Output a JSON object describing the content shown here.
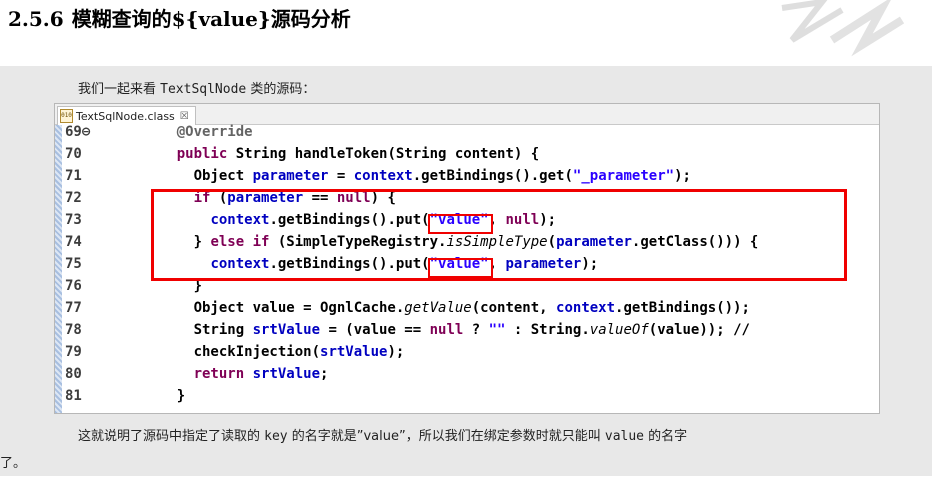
{
  "heading": {
    "number": "2.5.6",
    "title": "模糊查询的${value}源码分析"
  },
  "intro": {
    "before": "我们一起来看 ",
    "class_name": "TextSqlNode",
    "after": " 类的源码："
  },
  "editor": {
    "tab_label": "TextSqlNode.class",
    "tab_close": "☒",
    "file_icon_text": "010",
    "lines": [
      {
        "num": "69⊖",
        "parts": [
          {
            "t": "    ",
            "c": ""
          },
          {
            "t": "@Override",
            "c": "ann"
          }
        ]
      },
      {
        "num": "70",
        "parts": [
          {
            "t": "    ",
            "c": ""
          },
          {
            "t": "public",
            "c": "kw"
          },
          {
            "t": " String handleToken(String content) {",
            "c": ""
          }
        ]
      },
      {
        "num": "71",
        "parts": [
          {
            "t": "      Object ",
            "c": ""
          },
          {
            "t": "parameter",
            "c": "fld"
          },
          {
            "t": " = ",
            "c": ""
          },
          {
            "t": "context",
            "c": "fld"
          },
          {
            "t": ".getBindings().get(",
            "c": ""
          },
          {
            "t": "\"_parameter\"",
            "c": "str"
          },
          {
            "t": ");",
            "c": ""
          }
        ]
      },
      {
        "num": "72",
        "parts": [
          {
            "t": "      ",
            "c": ""
          },
          {
            "t": "if",
            "c": "kw"
          },
          {
            "t": " (",
            "c": ""
          },
          {
            "t": "parameter",
            "c": "fld"
          },
          {
            "t": " == ",
            "c": ""
          },
          {
            "t": "null",
            "c": "kw"
          },
          {
            "t": ") {",
            "c": ""
          }
        ]
      },
      {
        "num": "73",
        "parts": [
          {
            "t": "        ",
            "c": ""
          },
          {
            "t": "context",
            "c": "fld"
          },
          {
            "t": ".getBindings().put(",
            "c": ""
          },
          {
            "t": "\"value\"",
            "c": "str"
          },
          {
            "t": ", ",
            "c": ""
          },
          {
            "t": "null",
            "c": "kw"
          },
          {
            "t": ");",
            "c": ""
          }
        ]
      },
      {
        "num": "74",
        "parts": [
          {
            "t": "      } ",
            "c": ""
          },
          {
            "t": "else",
            "c": "kw"
          },
          {
            "t": " ",
            "c": ""
          },
          {
            "t": "if",
            "c": "kw"
          },
          {
            "t": " (SimpleTypeRegistry.",
            "c": ""
          },
          {
            "t": "isSimpleType",
            "c": "it"
          },
          {
            "t": "(",
            "c": ""
          },
          {
            "t": "parameter",
            "c": "fld"
          },
          {
            "t": ".getClass())) {",
            "c": ""
          }
        ]
      },
      {
        "num": "75",
        "parts": [
          {
            "t": "        ",
            "c": ""
          },
          {
            "t": "context",
            "c": "fld"
          },
          {
            "t": ".getBindings().put(",
            "c": ""
          },
          {
            "t": "\"value\"",
            "c": "str"
          },
          {
            "t": ", ",
            "c": ""
          },
          {
            "t": "parameter",
            "c": "fld"
          },
          {
            "t": ");",
            "c": ""
          }
        ]
      },
      {
        "num": "76",
        "parts": [
          {
            "t": "      }",
            "c": ""
          }
        ]
      },
      {
        "num": "77",
        "parts": [
          {
            "t": "      Object value = OgnlCache.",
            "c": ""
          },
          {
            "t": "getValue",
            "c": "it"
          },
          {
            "t": "(content, ",
            "c": ""
          },
          {
            "t": "context",
            "c": "fld"
          },
          {
            "t": ".getBindings());",
            "c": ""
          }
        ]
      },
      {
        "num": "78",
        "parts": [
          {
            "t": "      String ",
            "c": ""
          },
          {
            "t": "srtValue",
            "c": "fld"
          },
          {
            "t": " = (value == ",
            "c": ""
          },
          {
            "t": "null",
            "c": "kw"
          },
          {
            "t": " ? ",
            "c": ""
          },
          {
            "t": "\"\"",
            "c": "str"
          },
          {
            "t": " : String.",
            "c": ""
          },
          {
            "t": "valueOf",
            "c": "it"
          },
          {
            "t": "(value)); //",
            "c": ""
          }
        ]
      },
      {
        "num": "79",
        "parts": [
          {
            "t": "      checkInjection(",
            "c": ""
          },
          {
            "t": "srtValue",
            "c": "fld"
          },
          {
            "t": ");",
            "c": ""
          }
        ]
      },
      {
        "num": "80",
        "parts": [
          {
            "t": "      ",
            "c": ""
          },
          {
            "t": "return",
            "c": "kw"
          },
          {
            "t": " ",
            "c": ""
          },
          {
            "t": "srtValue",
            "c": "fld"
          },
          {
            "t": ";",
            "c": ""
          }
        ]
      },
      {
        "num": "81",
        "parts": [
          {
            "t": "    }",
            "c": ""
          }
        ]
      }
    ]
  },
  "explain": {
    "line1_a": "这就说明了源码中指定了读取的 ",
    "key_word": "key",
    "line1_b": " 的名字就是”value”，所以我们在绑定参数时就只能叫 ",
    "value_word": "value",
    "line1_c": " 的名字",
    "line2": "了。"
  },
  "colors": {
    "highlight_box": "#f00000",
    "keyword": "#7f0055",
    "string": "#2a00ff",
    "field": "#0000c0"
  }
}
